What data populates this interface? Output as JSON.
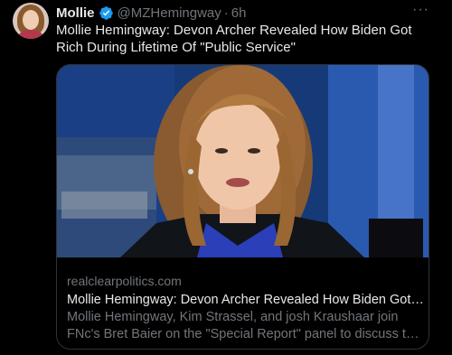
{
  "tweet": {
    "author_name": "Mollie",
    "handle": "@MZHemingway",
    "separator": "·",
    "time": "6h",
    "more": "···",
    "text": "Mollie Hemingway: Devon Archer Revealed How Biden Got Rich During Lifetime Of \"Public Service\""
  },
  "card": {
    "domain": "realclearpolitics.com",
    "title": "Mollie Hemingway: Devon Archer Revealed How Biden Got ...",
    "description_line1": "Mollie Hemingway, Kim Strassel, and josh Kraushaar join",
    "description_line2": "FNc's Bret Baier on the \"Special Report\" panel to discuss thi..."
  },
  "colors": {
    "background": "#000000",
    "text_primary": "#e7e9ea",
    "text_secondary": "#71767b",
    "verified_blue": "#1d9bf0",
    "card_border": "#2f3336"
  },
  "icons": {
    "verified": "verified-badge-icon",
    "more": "more-options-icon"
  }
}
